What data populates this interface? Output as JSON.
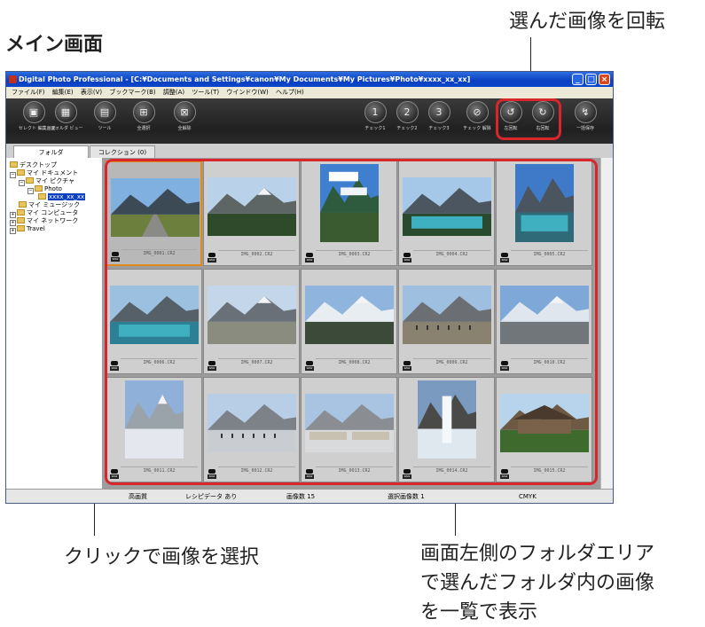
{
  "annotations": {
    "title": "メイン画面",
    "rotate": "選んだ画像を回転",
    "click": "クリックで画像を選択",
    "show_lines": [
      "画面左側のフォルダエリア",
      "で選んだフォルダ内の画像",
      "を一覧で表示"
    ]
  },
  "window": {
    "title": "Digital Photo Professional - [C:¥Documents and Settings¥canon¥My Documents¥My Pictures¥Photo¥xxxx_xx_xx]",
    "controls": [
      "_",
      "□",
      "×"
    ]
  },
  "menu": [
    "ファイル(F)",
    "編集(E)",
    "表示(V)",
    "ブックマーク(B)",
    "調整(A)",
    "ツール(T)",
    "ウインドウ(W)",
    "ヘルプ(H)"
  ],
  "toolbar": [
    {
      "label": "セレクト 編集画面",
      "icon": "edit-select-icon",
      "glyph": "▣"
    },
    {
      "label": "フォルダ ビュー",
      "icon": "folder-view-icon",
      "glyph": "▦"
    },
    {
      "label": "ツール",
      "icon": "tool-icon",
      "glyph": "▤"
    },
    {
      "label": "全選択",
      "icon": "select-all-icon",
      "glyph": "⊞"
    },
    {
      "label": "全解除",
      "icon": "deselect-all-icon",
      "glyph": "⊠"
    },
    {
      "label": "チェック1",
      "icon": "check1-icon",
      "glyph": "1"
    },
    {
      "label": "チェック2",
      "icon": "check2-icon",
      "glyph": "2"
    },
    {
      "label": "チェック3",
      "icon": "check3-icon",
      "glyph": "3"
    },
    {
      "label": "チェック 解除",
      "icon": "check-clear-icon",
      "glyph": "⊘"
    },
    {
      "label": "左回転",
      "icon": "rotate-left-icon",
      "glyph": "↺"
    },
    {
      "label": "右回転",
      "icon": "rotate-right-icon",
      "glyph": "↻"
    },
    {
      "label": "一括保存",
      "icon": "batch-save-icon",
      "glyph": "↯"
    }
  ],
  "tabs": [
    "フォルダ",
    "コレクション (0)"
  ],
  "tree": [
    {
      "label": "デスクトップ",
      "expander": ""
    },
    {
      "label": "マイ ドキュメント",
      "expander": "−"
    },
    {
      "label": "マイ ピクチャ",
      "expander": "−"
    },
    {
      "label": "Photo",
      "expander": "−"
    },
    {
      "label": "xxxx_xx_xx",
      "expander": ""
    },
    {
      "label": "マイ ミュージック",
      "expander": ""
    },
    {
      "label": "マイ コンピュータ",
      "expander": "+"
    },
    {
      "label": "マイ ネットワーク",
      "expander": "+"
    },
    {
      "label": "Travel",
      "expander": "+"
    }
  ],
  "camera_badge": "RAW",
  "thumbnails": [
    {
      "file": "IMG_0001.CR2",
      "scene": "road-mountains",
      "orientation": "landscape",
      "selected": true
    },
    {
      "file": "IMG_0002.CR2",
      "scene": "forest-mountain",
      "orientation": "landscape",
      "selected": false
    },
    {
      "file": "IMG_0003.CR2",
      "scene": "sky-clouds",
      "orientation": "portrait",
      "selected": false
    },
    {
      "file": "IMG_0004.CR2",
      "scene": "turquoise-lake",
      "orientation": "landscape",
      "selected": false
    },
    {
      "file": "IMG_0005.CR2",
      "scene": "lake-reflection",
      "orientation": "portrait",
      "selected": false
    },
    {
      "file": "IMG_0006.CR2",
      "scene": "lake-peaks",
      "orientation": "landscape",
      "selected": false
    },
    {
      "file": "IMG_0007.CR2",
      "scene": "glacier-valley",
      "orientation": "landscape",
      "selected": false
    },
    {
      "file": "IMG_0008.CR2",
      "scene": "snow-mountain",
      "orientation": "landscape",
      "selected": false
    },
    {
      "file": "IMG_0009.CR2",
      "scene": "viewpoint-crowd",
      "orientation": "landscape",
      "selected": false
    },
    {
      "file": "IMG_0010.CR2",
      "scene": "glacier-snow",
      "orientation": "landscape",
      "selected": false
    },
    {
      "file": "IMG_0011.CR2",
      "scene": "icefield",
      "orientation": "portrait",
      "selected": false
    },
    {
      "file": "IMG_0012.CR2",
      "scene": "glacier-people",
      "orientation": "landscape",
      "selected": false
    },
    {
      "file": "IMG_0013.CR2",
      "scene": "snow-coaches",
      "orientation": "landscape",
      "selected": false
    },
    {
      "file": "IMG_0014.CR2",
      "scene": "waterfall",
      "orientation": "portrait",
      "selected": false
    },
    {
      "file": "IMG_0015.CR2",
      "scene": "lodge",
      "orientation": "landscape",
      "selected": false
    }
  ],
  "status": [
    "高画質",
    "レシピデータ あり",
    "画像数 15",
    "選択画像数 1",
    "CMYK"
  ],
  "colors": {
    "highlight": "#d9262c",
    "selection": "#e08a1a",
    "titlebar": "#0a3fbf"
  }
}
